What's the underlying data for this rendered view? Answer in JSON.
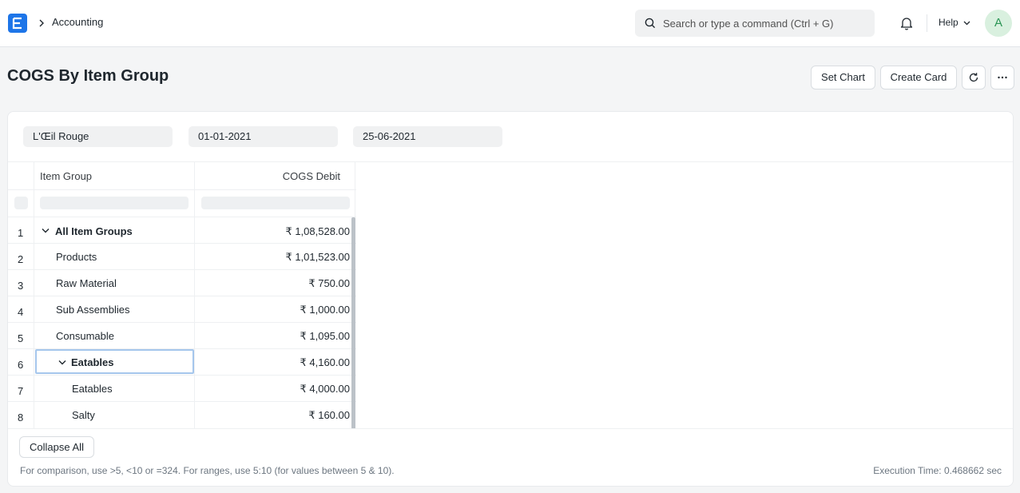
{
  "navbar": {
    "breadcrumb": "Accounting",
    "search_placeholder": "Search or type a command (Ctrl + G)",
    "help_label": "Help",
    "avatar_initial": "A"
  },
  "page": {
    "title": "COGS By Item Group",
    "actions": {
      "set_chart": "Set Chart",
      "create_card": "Create Card"
    }
  },
  "filters": {
    "company": "L'Œil Rouge",
    "from_date": "01-01-2021",
    "to_date": "25-06-2021"
  },
  "table": {
    "columns": [
      "Item Group",
      "COGS Debit"
    ],
    "rows": [
      {
        "num": "1",
        "name": "All Item Groups",
        "amount": "₹ 1,08,528.00",
        "level": 0,
        "group": true
      },
      {
        "num": "2",
        "name": "Products",
        "amount": "₹ 1,01,523.00",
        "level": 1,
        "group": false
      },
      {
        "num": "3",
        "name": "Raw Material",
        "amount": "₹ 750.00",
        "level": 1,
        "group": false
      },
      {
        "num": "4",
        "name": "Sub Assemblies",
        "amount": "₹ 1,000.00",
        "level": 1,
        "group": false
      },
      {
        "num": "5",
        "name": "Consumable",
        "amount": "₹ 1,095.00",
        "level": 1,
        "group": false
      },
      {
        "num": "6",
        "name": "Eatables",
        "amount": "₹ 4,160.00",
        "level": 1,
        "group": true
      },
      {
        "num": "7",
        "name": "Eatables",
        "amount": "₹ 4,000.00",
        "level": 2,
        "group": false
      },
      {
        "num": "8",
        "name": "Salty",
        "amount": "₹ 160.00",
        "level": 2,
        "group": false
      }
    ]
  },
  "footer": {
    "collapse_label": "Collapse All",
    "hint": "For comparison, use >5, <10 or =324. For ranges, use 5:10 (for values between 5 & 10).",
    "execution_time": "Execution Time: 0.468662 sec"
  },
  "colors": {
    "brand": "#1d75e8",
    "avatar_bg": "#d9f0df",
    "avatar_fg": "#2a9454",
    "focus_outline": "#a5c6ec"
  }
}
